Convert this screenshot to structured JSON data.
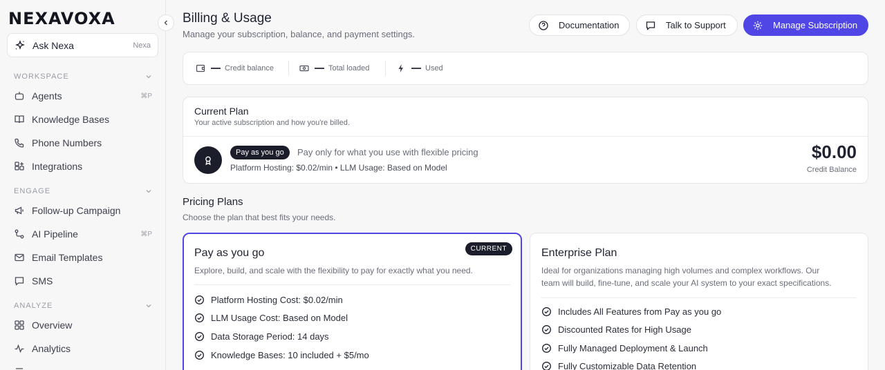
{
  "sidebar": {
    "logo": "NEXAVOXA",
    "ask": {
      "label": "Ask Nexa",
      "tag": "Nexa"
    },
    "sections": [
      {
        "label": "WORKSPACE",
        "items": [
          {
            "label": "Agents",
            "kbd": "⌘P",
            "icon": "agent-icon"
          },
          {
            "label": "Knowledge Bases",
            "kbd": "",
            "icon": "book-icon"
          },
          {
            "label": "Phone Numbers",
            "kbd": "",
            "icon": "phone-icon"
          },
          {
            "label": "Integrations",
            "kbd": "",
            "icon": "integrations-icon"
          }
        ]
      },
      {
        "label": "ENGAGE",
        "items": [
          {
            "label": "Follow-up Campaign",
            "kbd": "",
            "icon": "megaphone-icon"
          },
          {
            "label": "AI Pipeline",
            "kbd": "⌘P",
            "icon": "pipeline-icon"
          },
          {
            "label": "Email Templates",
            "kbd": "",
            "icon": "mail-icon"
          },
          {
            "label": "SMS",
            "kbd": "",
            "icon": "message-icon"
          }
        ]
      },
      {
        "label": "ANALYZE",
        "items": [
          {
            "label": "Overview",
            "kbd": "",
            "icon": "grid-icon"
          },
          {
            "label": "Analytics",
            "kbd": "",
            "icon": "activity-icon"
          }
        ]
      }
    ]
  },
  "header": {
    "title": "Billing & Usage",
    "subtitle": "Manage your subscription, balance, and payment settings.",
    "buttons": {
      "docs": "Documentation",
      "support": "Talk to Support",
      "manage": "Manage Subscription"
    }
  },
  "stats": [
    {
      "value": "—",
      "label": "Credit balance",
      "icon": "wallet-icon"
    },
    {
      "value": "—",
      "label": "Total loaded",
      "icon": "cash-icon"
    },
    {
      "value": "—",
      "label": "Used",
      "icon": "bolt-icon"
    }
  ],
  "current_plan": {
    "title": "Current Plan",
    "subtitle": "Your active subscription and how you're billed.",
    "badge": "Pay as you go",
    "description": "Pay only for what you use with flexible pricing",
    "meta": "Platform Hosting: $0.02/min • LLM Usage: Based on Model",
    "balance": "$0.00",
    "balance_label": "Credit Balance"
  },
  "pricing": {
    "title": "Pricing Plans",
    "subtitle": "Choose the plan that best fits your needs.",
    "plans": [
      {
        "name": "Pay as you go",
        "tag": "CURRENT",
        "description": "Explore, build, and scale with the flexibility to pay for exactly what you need.",
        "features": [
          "Platform Hosting Cost: $0.02/min",
          "LLM Usage Cost: Based on Model",
          "Data Storage Period: 14 days",
          "Knowledge Bases: 10 included + $5/mo"
        ]
      },
      {
        "name": "Enterprise Plan",
        "description_line1": "Ideal for organizations managing high volumes and complex workflows. Our",
        "description_line2": "team will build, fine-tune, and scale your AI system to your exact specifications.",
        "features": [
          "Includes All Features from Pay as you go",
          "Discounted Rates for High Usage",
          "Fully Managed Deployment & Launch",
          "Fully Customizable Data Retention"
        ]
      }
    ]
  },
  "colors": {
    "accent": "#4f46e5",
    "dark": "#1b1e2a"
  }
}
